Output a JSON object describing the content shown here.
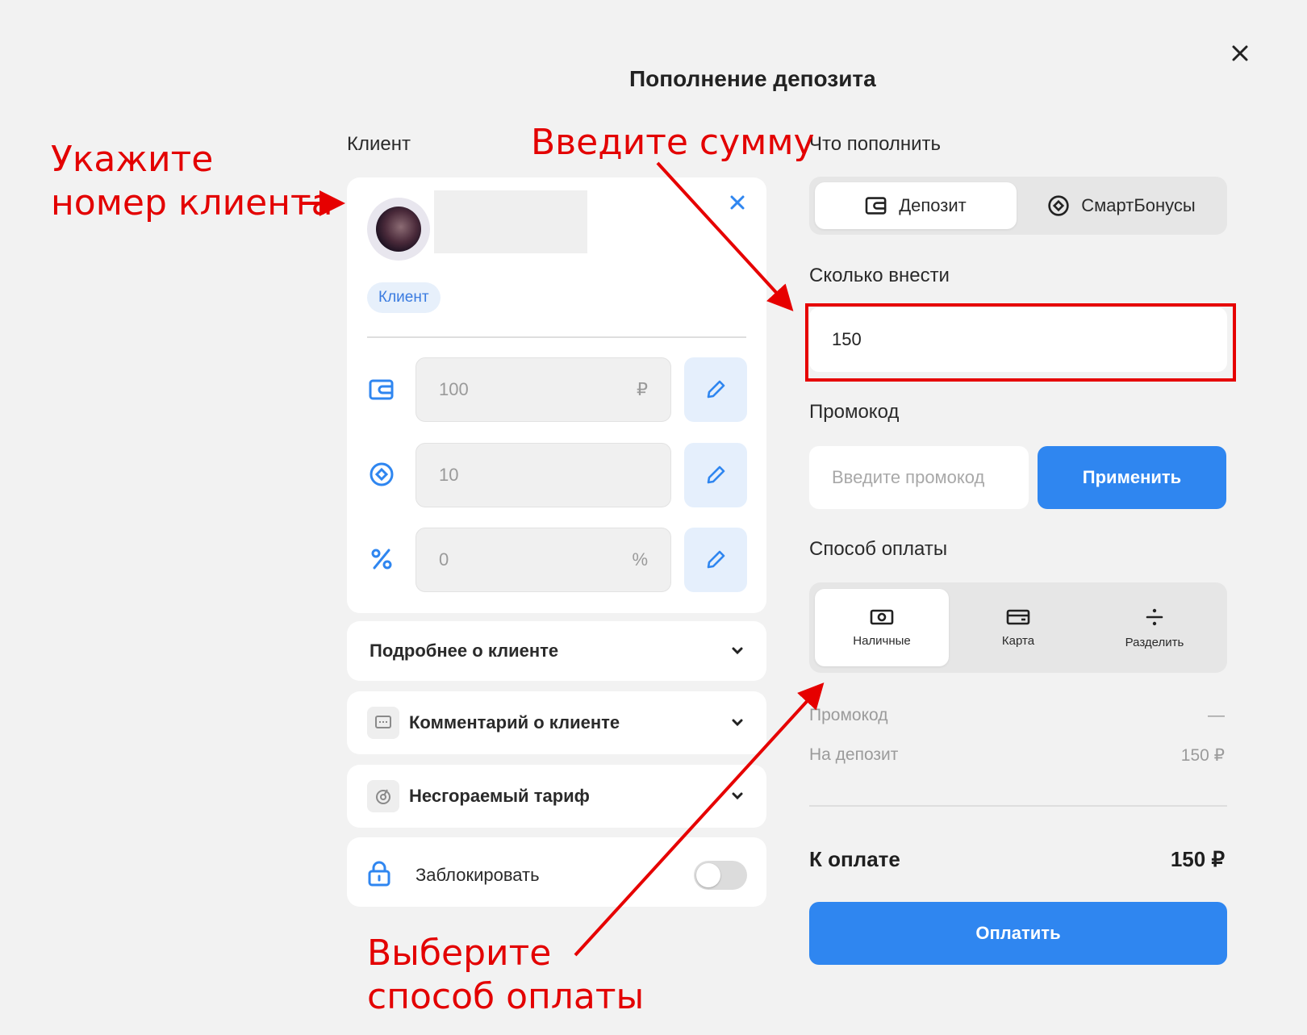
{
  "modal": {
    "title": "Пополнение депозита"
  },
  "left": {
    "section_label": "Клиент",
    "client_chip": "Клиент",
    "balances": [
      {
        "value": "100",
        "suffix": "₽",
        "icon": "wallet-icon"
      },
      {
        "value": "10",
        "suffix": "",
        "icon": "bonus-icon"
      },
      {
        "value": "0",
        "suffix": "%",
        "icon": "percent-icon"
      }
    ],
    "accordions": {
      "details": "Подробнее о клиенте",
      "comment": "Комментарий о клиенте",
      "tariff": "Несгораемый тариф"
    },
    "block_label": "Заблокировать",
    "block_enabled": false
  },
  "right": {
    "what_label": "Что пополнить",
    "what_options": [
      "Депозит",
      "СмартБонусы"
    ],
    "what_selected": "Депозит",
    "amount_label": "Сколько внести",
    "amount_value": "150",
    "promo_label": "Промокод",
    "promo_placeholder": "Введите промокод",
    "promo_apply": "Применить",
    "payment_label": "Способ оплаты",
    "payment_options": [
      "Наличные",
      "Карта",
      "Разделить"
    ],
    "payment_selected": "Наличные",
    "summary": {
      "promo_label": "Промокод",
      "promo_value": "—",
      "deposit_label": "На депозит",
      "deposit_value": "150 ₽"
    },
    "total_label": "К оплате",
    "total_value": "150 ₽",
    "pay_button": "Оплатить"
  },
  "annotations": {
    "client_number": [
      "Укажите",
      "номер клиента"
    ],
    "enter_amount": "Введите сумму",
    "choose_payment": [
      "Выберите",
      "способ оплаты"
    ]
  },
  "colors": {
    "accent": "#2f86f0",
    "annotation": "#e30000"
  }
}
